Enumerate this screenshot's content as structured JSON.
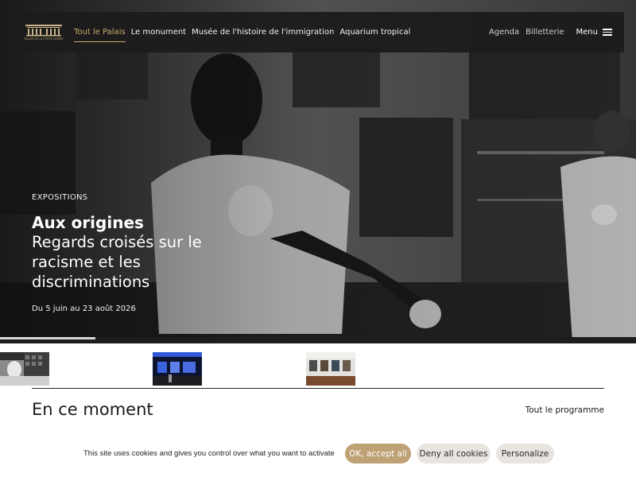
{
  "header": {
    "logo_text": "PALAIS DE LA PORTE DORÉE",
    "nav": [
      {
        "label": "Tout le Palais",
        "active": true
      },
      {
        "label": "Le monument",
        "active": false
      },
      {
        "label": "Musée de l'histoire de l'immigration",
        "active": false
      },
      {
        "label": "Aquarium tropical",
        "active": false
      }
    ],
    "utility": [
      {
        "label": "Agenda"
      },
      {
        "label": "Billetterie"
      }
    ],
    "menu_label": "Menu",
    "menu_icon": "hamburger-icon"
  },
  "hero": {
    "kicker": "EXPOSITIONS",
    "title": "Aux origines",
    "subtitle": "Regards croisés sur le racisme et les discriminations",
    "dates": "Du 5 juin au 23 août 2026",
    "slide_progress": 0.15
  },
  "thumbnails": [
    {
      "label": "slide-1"
    },
    {
      "label": "slide-2"
    },
    {
      "label": "slide-3"
    }
  ],
  "section": {
    "title": "En ce moment",
    "link": "Tout le programme"
  },
  "cookie": {
    "text": "This site uses cookies and gives you control over what you want to activate",
    "accept": "OK, accept all",
    "deny": "Deny all cookies",
    "personalize": "Personalize"
  },
  "colors": {
    "accent_gold": "#c9a96e",
    "accept_button": "#bfa176",
    "secondary_button": "#e8e4e0",
    "nav_bg": "#1c1c1c"
  }
}
